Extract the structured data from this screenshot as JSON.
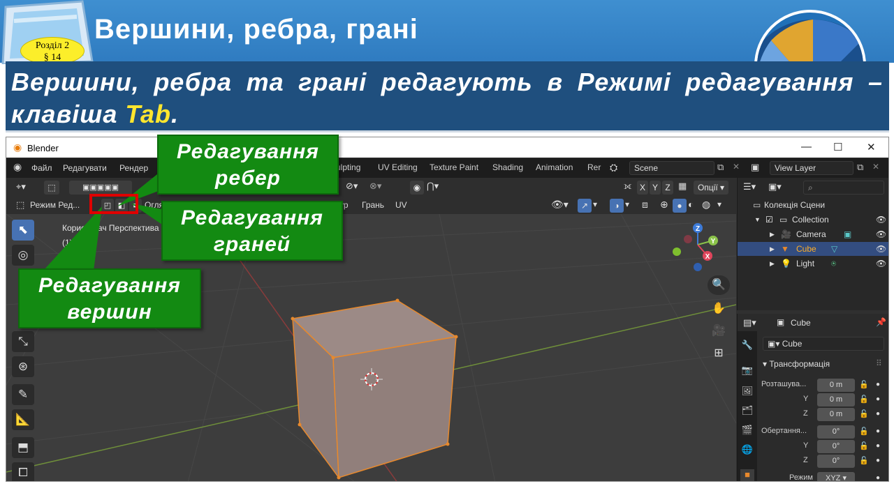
{
  "slide": {
    "title": "Вершини, ребра, грані",
    "badge_line1": "Розділ 2",
    "badge_line2": "§ 14",
    "lead_part1": "Вершини, ребра та грані редагують в Режимі редагування – клавіша ",
    "lead_key": "Tab",
    "lead_end": "."
  },
  "callouts": {
    "edges": "Редагування ребер",
    "faces": "Редагування граней",
    "vertices": "Редагування вершин"
  },
  "blender": {
    "window_title": "Blender",
    "window_controls": [
      "—",
      "☐",
      "✕"
    ],
    "menu": [
      "Файл",
      "Редагувати",
      "Рендер"
    ],
    "workspaces": [
      "ulpting",
      "UV Editing",
      "Texture Paint",
      "Shading",
      "Animation",
      "Rer"
    ],
    "scene_name": "Scene",
    "view_layer": "View Layer",
    "mode_label": "Режим Ред...",
    "header_menus": [
      "Огля",
      "ур",
      "Грань",
      "UV"
    ],
    "axis_buttons": [
      "X",
      "Y",
      "Z"
    ],
    "options_label": "Опції",
    "viewport_label_1": "Користувач Перспектива",
    "viewport_label_2": "(1)",
    "gizmo_axes": [
      "Z",
      "Y",
      "X"
    ]
  },
  "outliner": {
    "search_placeholder": "",
    "scene_collection": "Колекція Сцени",
    "collection": "Collection",
    "items": [
      "Camera",
      "Cube",
      "Light"
    ]
  },
  "properties": {
    "object_name": "Cube",
    "data_name": "Cube",
    "section": "Трансформація",
    "location_label": "Розташува...",
    "rotation_label": "Обертання...",
    "mode_label": "Режим",
    "mode_value": "XYZ",
    "axes": [
      "Y",
      "Z"
    ],
    "location_values": [
      "0 m",
      "0 m",
      "0 m"
    ],
    "rotation_values": [
      "0°",
      "0°",
      "0°"
    ]
  },
  "colors": {
    "header_blue": "#2f7bc0",
    "banner_navy": "#1f4f7e",
    "key_yellow": "#ffe62e",
    "callout_green": "#138a12",
    "highlight_red": "#e00000",
    "selected_orange": "#ffaf29"
  }
}
